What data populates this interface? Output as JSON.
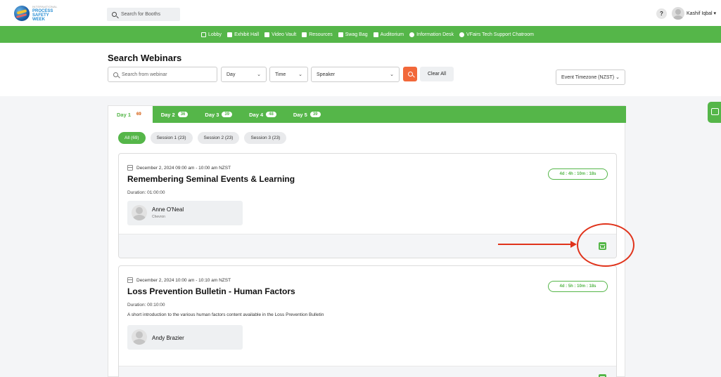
{
  "header": {
    "logo": {
      "line1": "INTERNATIONAL",
      "line2": "PROCESS",
      "line3": "SAFETY",
      "line4": "WEEK"
    },
    "booth_search_placeholder": "Search for Booths",
    "help_label": "?",
    "user_name": "Kashif Iqbal ▾"
  },
  "nav": {
    "items": [
      {
        "label": "Lobby",
        "icon": "lobby-icon"
      },
      {
        "label": "Exhibit Hall",
        "icon": "building-icon"
      },
      {
        "label": "Video Vault",
        "icon": "video-icon"
      },
      {
        "label": "Resources",
        "icon": "folder-icon"
      },
      {
        "label": "Swag Bag",
        "icon": "bag-icon"
      },
      {
        "label": "Auditorium",
        "icon": "list-icon"
      },
      {
        "label": "Information Desk",
        "icon": "info-icon"
      },
      {
        "label": "VFairs Tech Support Chatroom",
        "icon": "chat-icon"
      }
    ]
  },
  "search": {
    "title": "Search Webinars",
    "input_placeholder": "Search from webinar",
    "day_select": "Day",
    "time_select": "Time",
    "speaker_select": "Speaker",
    "clear_label": "Clear All",
    "timezone_select": "Event Timezone (NZST) ⌄"
  },
  "day_tabs": [
    {
      "label": "Day 1",
      "count": "69"
    },
    {
      "label": "Day 2",
      "count": "36"
    },
    {
      "label": "Day 3",
      "count": "39"
    },
    {
      "label": "Day 4",
      "count": "48"
    },
    {
      "label": "Day 5",
      "count": "39"
    }
  ],
  "session_pills": [
    "All (69)",
    "Session 1 (23)",
    "Session 2 (23)",
    "Session 3 (23)"
  ],
  "webinars": [
    {
      "date": "December 2, 2024 09:00 am - 10:00 am NZST",
      "title": "Remembering Seminal Events & Learning",
      "duration": "Duration: 01:00:00",
      "description": "",
      "countdown": "4d : 4h : 10m : 18s",
      "speaker": {
        "name": "Anne O'Neal",
        "org": "Chevron"
      }
    },
    {
      "date": "December 2, 2024 10:00 am - 10:10 am NZST",
      "title": "Loss Prevention Bulletin - Human Factors",
      "duration": "Duration: 00:10:00",
      "description": "A short introduction to the various human factors content available in the Loss Prevention Bulletin",
      "countdown": "4d : 5h : 10m : 18s",
      "speaker": {
        "name": "Andy Brazier",
        "org": ""
      }
    }
  ],
  "colors": {
    "brand_green": "#55b649",
    "search_orange": "#f2683a",
    "annotation_red": "#e0331b"
  }
}
